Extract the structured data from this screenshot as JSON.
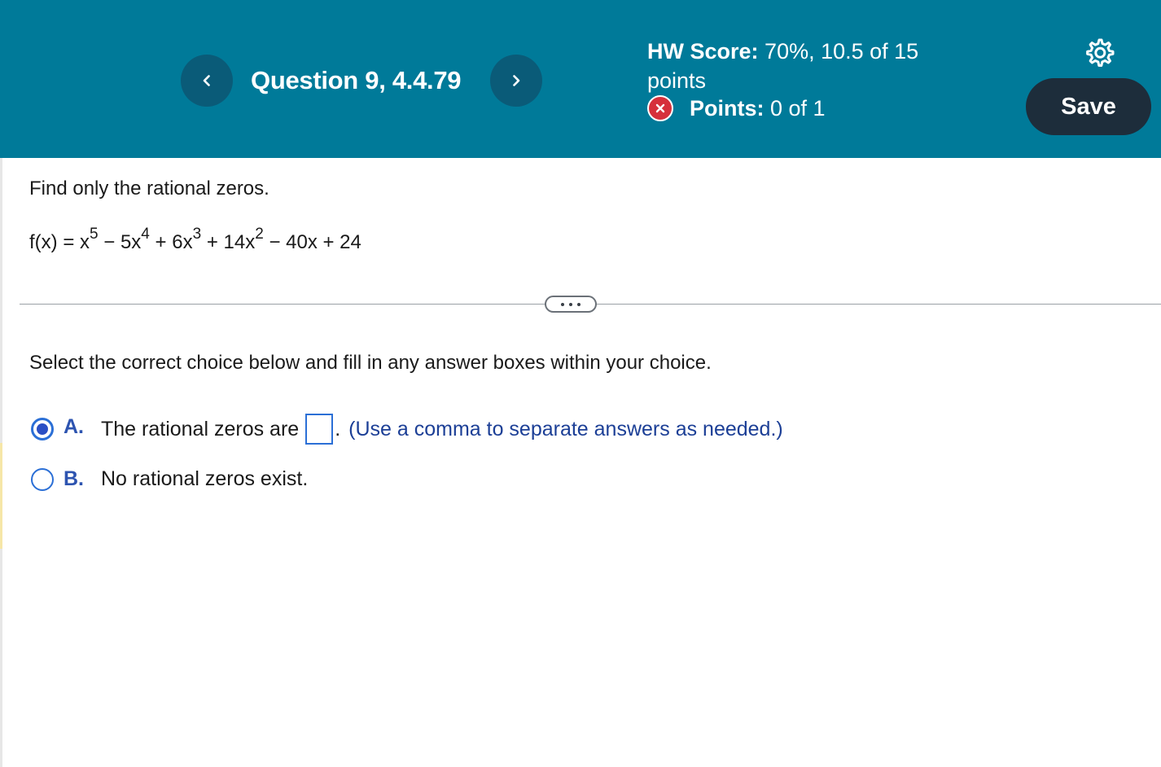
{
  "header": {
    "question_title": "Question 9, 4.4.79",
    "prev_icon": "chevron-left-icon",
    "next_icon": "chevron-right-icon",
    "hw_score_label": "HW Score:",
    "hw_score_value": "70%, 10.5 of 15",
    "hw_score_unit": "points",
    "points_label": "Points:",
    "points_value": "0 of 1",
    "points_status_icon": "incorrect-x-icon",
    "settings_icon": "gear-icon",
    "save_label": "Save"
  },
  "question": {
    "instruction": "Find only the rational zeros.",
    "equation": {
      "lhs": "f(x) = x",
      "exp5": "5",
      "t2": " − 5x",
      "exp4": "4",
      "t3": " + 6x",
      "exp3": "3",
      "t4": " + 14x",
      "exp2": "2",
      "t5": " − 40x + 24"
    }
  },
  "expand_icon": "ellipsis-icon",
  "answer": {
    "prompt": "Select the correct choice below and fill in any answer boxes within your choice.",
    "choices": [
      {
        "letter": "A.",
        "text": "The rational zeros are",
        "after_box": ".",
        "hint": "(Use a comma to separate answers as needed.)",
        "selected": true,
        "input_value": ""
      },
      {
        "letter": "B.",
        "text": "No rational zeros exist.",
        "selected": false
      }
    ]
  },
  "colors": {
    "header_bg": "#007a99",
    "nav_button_bg": "#0a5b78",
    "save_button_bg": "#1d2d3b",
    "incorrect_red": "#d6303b",
    "choice_letter": "#2d54b0",
    "hint_text": "#1c3f96",
    "radio_blue": "#2b6fd6"
  }
}
